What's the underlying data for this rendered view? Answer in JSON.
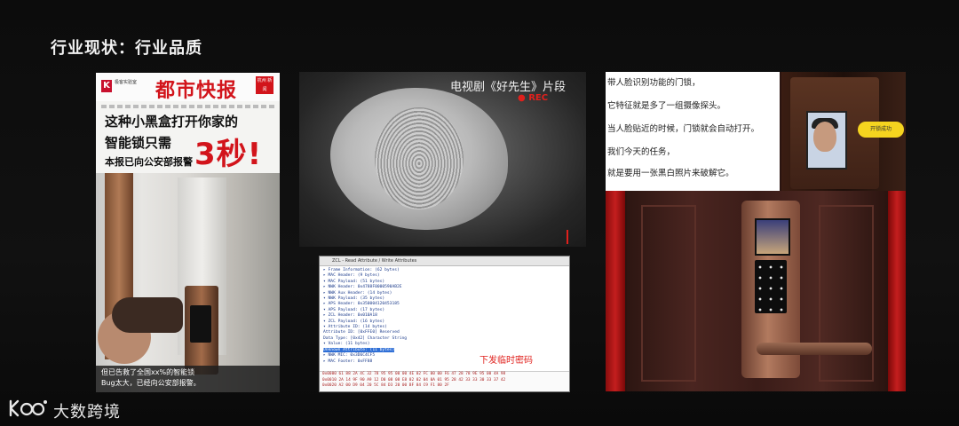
{
  "slide": {
    "title": "行业现状：行业品质"
  },
  "newspaper": {
    "lab_label": "极客实验室",
    "masthead": "都市快报",
    "badge": "杭州 新闻",
    "headline_line1": "这种小黑盒打开你家的",
    "headline_line2": "智能锁只需",
    "headline_line3": "本报已向公安部报警",
    "headline_big": "3秒!",
    "caption_line1": "但已告救了全国xx%的智能锁",
    "caption_line2": "Bug太大，已经向公安部报警。"
  },
  "video": {
    "title": "电视剧《好先生》片段",
    "rec": "● REC"
  },
  "wireshark": {
    "window_title": "ZCL - Read Attribute / Write Attributes",
    "tree": [
      "▸ Frame Information: (62 bytes)",
      "▸ MAC Header: (9 bytes)",
      "▾ MAC Payload: (51 bytes)",
      "   ▸ NWK Header: 0x4788F0000590AB2E",
      "   ▸ NWK Aux Header: (14 bytes)",
      "   ▾ NWK Payload: (35 bytes)",
      "      ▸ APS Header: 0x350004120453185",
      "      ▾ APS Payload: (17 bytes)",
      "         ▸ ZCL Header: 0x010A18",
      "         ▾ ZCL Payload: (16 bytes)",
      "            ▾ Attribute ID: (14 bytes)",
      "               Attribute ID: [0xFFE0] Reserved",
      "               Data Type: [0x42] Character String",
      "            ▾ Value: (11 bytes)",
      "               Unknown Attribute: (11 bytes)",
      "   ▸ NWK MIC: 0x3D6C4CF5",
      "▸ MAC Footer: 0xFF88"
    ],
    "selected_index": 14,
    "annotation": "下发临时密码",
    "hex": [
      "0x0000  61 88 2A 4C 32 78 95 95 00 00 4E 02 FC 00 00 F6 47 28 78 9E 95 00 4A 98",
      "0x0010  2A 14 9F 90 A9 12 D0 08 08 E8 02 02 04 0A 01 95 28 42 33 33 30 33 37 42",
      "0x0020  A2 00 D9 04 20 5C 84 D3 20 00 BF 84 C9 F1 80 2F"
    ]
  },
  "facelock": {
    "text_lines": [
      "带人脸识别功能的门锁，",
      "它特征就是多了一组摄像探头。",
      "当人脸贴近的时候，门锁就会自动打开。",
      "我们今天的任务，",
      "就是要用一张黑白照片来破解它。"
    ],
    "bubble": "开锁成功"
  },
  "footer": {
    "brand": "大数跨境"
  },
  "colors": {
    "accent_red": "#d2141b",
    "rec_red": "#e0201c",
    "selection_blue": "#2f6fd6"
  }
}
